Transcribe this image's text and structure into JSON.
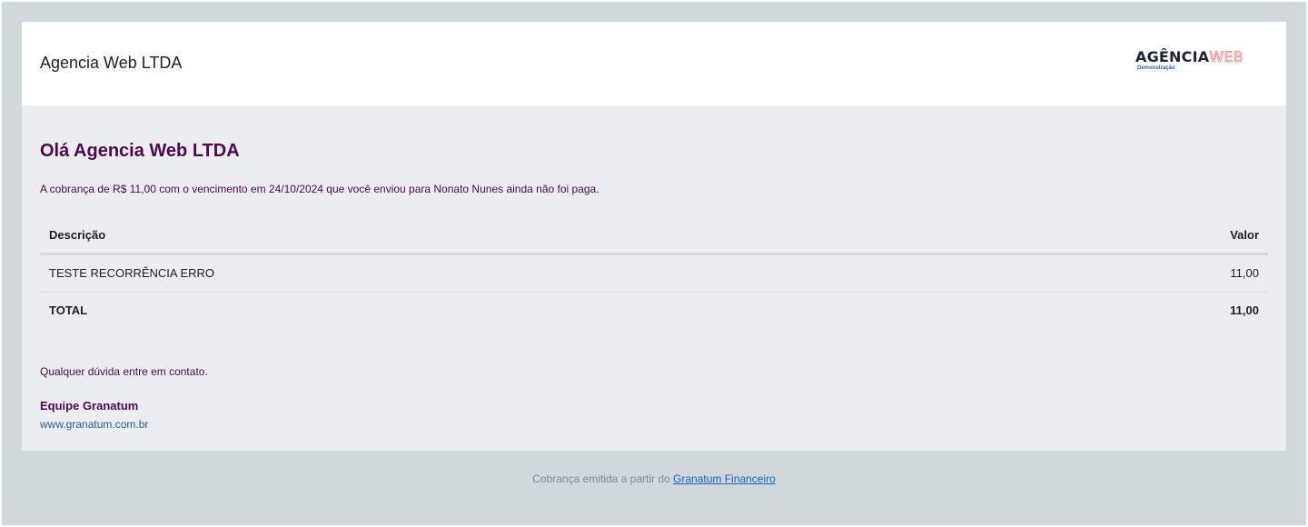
{
  "header": {
    "company_name": "Agencia Web LTDA",
    "logo": {
      "text_main": "AGÊNCIA",
      "text_accent": "WEB",
      "subtitle": "Demonstração"
    }
  },
  "content": {
    "greeting": "Olá Agencia Web LTDA",
    "message": "A cobrança de R$ 11,00 com o vencimento em 24/10/2024 que você enviou para Nonato Nunes ainda não foi paga.",
    "table": {
      "headers": {
        "description": "Descrição",
        "value": "Valor"
      },
      "rows": [
        {
          "description": "TESTE RECORRÊNCIA ERRO",
          "value": "11,00"
        }
      ],
      "total": {
        "label": "TOTAL",
        "value": "11,00"
      }
    },
    "contact_text": "Qualquer dúvida entre em contato.",
    "team_name": "Equipe Granatum",
    "website": "www.granatum.com.br"
  },
  "footer": {
    "text": "Cobrança emitida a partir do",
    "link_text": "Granatum Financeiro"
  },
  "colors": {
    "page_background": "#d0d8dc",
    "card_background": "#ecedf0",
    "header_background": "#ffffff",
    "primary_text": "#4d0a4a",
    "link": "#1e5fbf",
    "site_link": "#2a5e86"
  }
}
